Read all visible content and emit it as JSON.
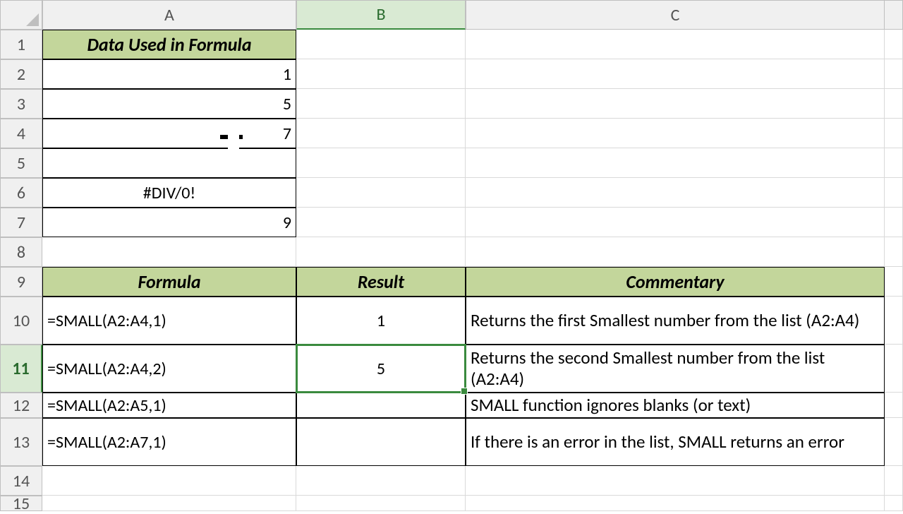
{
  "columns": [
    "A",
    "B",
    "C"
  ],
  "rows": [
    "1",
    "2",
    "3",
    "4",
    "5",
    "6",
    "7",
    "8",
    "9",
    "10",
    "11",
    "12",
    "13",
    "14",
    "15"
  ],
  "selected": {
    "col": "B",
    "row": "11"
  },
  "topTable": {
    "header": "Data Used in Formula",
    "valuesA": {
      "r2": "1",
      "r3": "5",
      "r4": "7",
      "r5": "",
      "r6": "#DIV/0!",
      "r7": "9"
    }
  },
  "lowerHeaders": {
    "a": "Formula",
    "b": "Result",
    "c": "Commentary"
  },
  "rowsData": {
    "r10": {
      "formula": "=SMALL(A2:A4,1)",
      "result": "1",
      "comment": "Returns the first Smallest number from the list (A2:A4)"
    },
    "r11": {
      "formula": "=SMALL(A2:A4,2)",
      "result": "5",
      "comment": "Returns the second Smallest number from the list (A2:A4)"
    },
    "r12": {
      "formula": "=SMALL(A2:A5,1)",
      "result": "",
      "comment": "SMALL function ignores blanks (or text)"
    },
    "r13": {
      "formula": "=SMALL(A2:A7,1)",
      "result": "",
      "comment": "If there is an error in the list, SMALL returns an error"
    }
  },
  "chart_data": {
    "type": "table",
    "title": "SMALL function examples",
    "input_list": [
      1,
      5,
      7,
      null,
      "#DIV/0!",
      9
    ],
    "examples": [
      {
        "formula": "=SMALL(A2:A4,1)",
        "result": 1,
        "comment": "Returns the first Smallest number from the list (A2:A4)"
      },
      {
        "formula": "=SMALL(A2:A4,2)",
        "result": 5,
        "comment": "Returns the second Smallest number from the list (A2:A4)"
      },
      {
        "formula": "=SMALL(A2:A5,1)",
        "result": null,
        "comment": "SMALL function ignores blanks (or text)"
      },
      {
        "formula": "=SMALL(A2:A7,1)",
        "result": null,
        "comment": "If there is an error in the list, SMALL returns an error"
      }
    ]
  }
}
